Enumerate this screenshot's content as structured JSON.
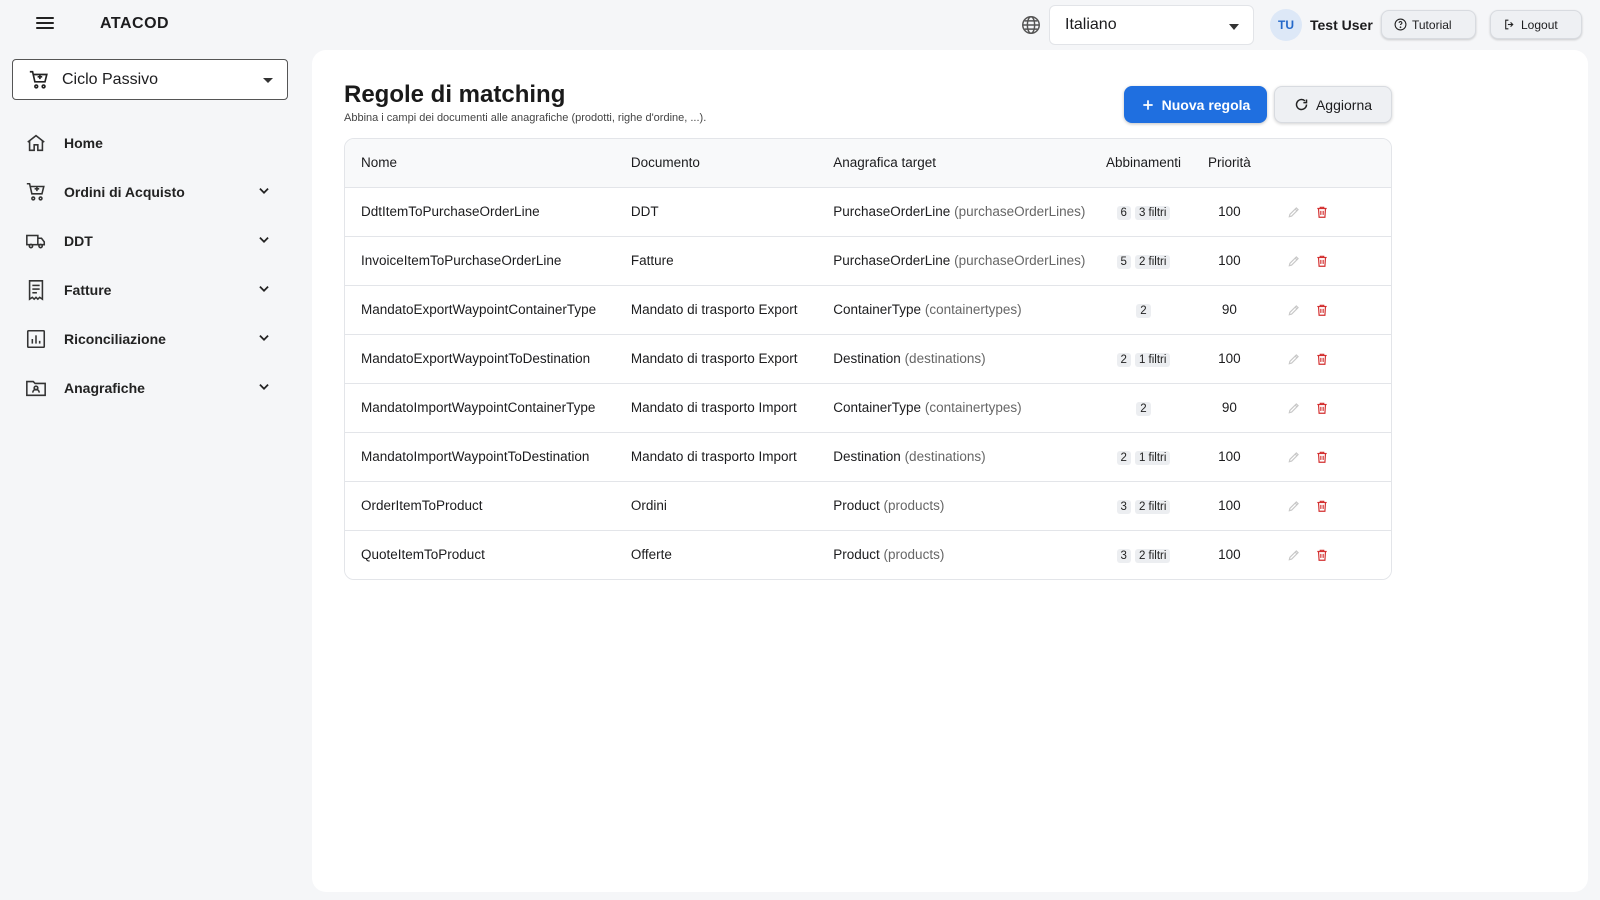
{
  "header": {
    "brand": "ATACOD",
    "language": "Italiano",
    "user_initials": "TU",
    "user_name": "Test User",
    "tutorial_label": "Tutorial",
    "logout_label": "Logout"
  },
  "sidebar": {
    "module": "Ciclo Passivo",
    "items": [
      {
        "label": "Home",
        "icon": "home-icon"
      },
      {
        "label": "Ordini di Acquisto",
        "icon": "cart-icon"
      },
      {
        "label": "DDT",
        "icon": "truck-icon"
      },
      {
        "label": "Fatture",
        "icon": "receipt-icon"
      },
      {
        "label": "Riconciliazione",
        "icon": "chart-icon"
      },
      {
        "label": "Anagrafiche",
        "icon": "contact-folder-icon"
      }
    ]
  },
  "main": {
    "title": "Regole di matching",
    "subtitle": "Abbina i campi dei documenti alle anagrafiche (prodotti, righe d'ordine, ...).",
    "new_rule_label": "Nuova regola",
    "refresh_label": "Aggiorna",
    "columns": [
      "Nome",
      "Documento",
      "Anagrafica target",
      "Abbinamenti",
      "Priorità"
    ],
    "rows": [
      {
        "name": "DdtItemToPurchaseOrderLine",
        "document": "DDT",
        "target": "PurchaseOrderLine",
        "target_key": "(purchaseOrderLines)",
        "matches": "6",
        "filters": "3 filtri",
        "priority": "100"
      },
      {
        "name": "InvoiceItemToPurchaseOrderLine",
        "document": "Fatture",
        "target": "PurchaseOrderLine",
        "target_key": "(purchaseOrderLines)",
        "matches": "5",
        "filters": "2 filtri",
        "priority": "100"
      },
      {
        "name": "MandatoExportWaypointContainerType",
        "document": "Mandato di trasporto Export",
        "target": "ContainerType",
        "target_key": "(containertypes)",
        "matches": "2",
        "filters": "",
        "priority": "90"
      },
      {
        "name": "MandatoExportWaypointToDestination",
        "document": "Mandato di trasporto Export",
        "target": "Destination",
        "target_key": "(destinations)",
        "matches": "2",
        "filters": "1 filtri",
        "priority": "100"
      },
      {
        "name": "MandatoImportWaypointContainerType",
        "document": "Mandato di trasporto Import",
        "target": "ContainerType",
        "target_key": "(containertypes)",
        "matches": "2",
        "filters": "",
        "priority": "90"
      },
      {
        "name": "MandatoImportWaypointToDestination",
        "document": "Mandato di trasporto Import",
        "target": "Destination",
        "target_key": "(destinations)",
        "matches": "2",
        "filters": "1 filtri",
        "priority": "100"
      },
      {
        "name": "OrderItemToProduct",
        "document": "Ordini",
        "target": "Product",
        "target_key": "(products)",
        "matches": "3",
        "filters": "2 filtri",
        "priority": "100"
      },
      {
        "name": "QuoteItemToProduct",
        "document": "Offerte",
        "target": "Product",
        "target_key": "(products)",
        "matches": "3",
        "filters": "2 filtri",
        "priority": "100"
      }
    ]
  },
  "colors": {
    "primary": "#1f6fe0",
    "delete": "#d32f2f",
    "edit_disabled": "#c8c8c8"
  }
}
